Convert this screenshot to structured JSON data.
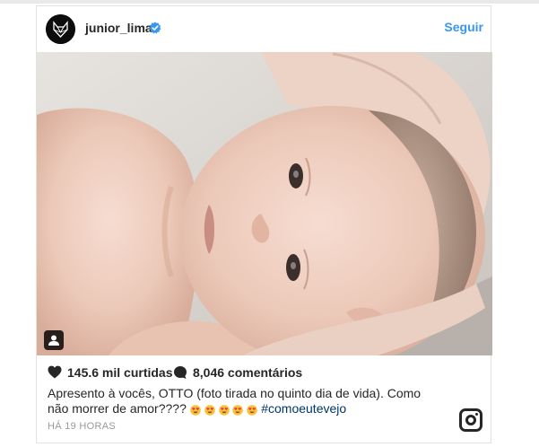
{
  "post": {
    "username": "junior_lima",
    "follow_label": "Seguir",
    "likes_text": "145.6 mil curtidas",
    "comments_text": "8,046 comentários",
    "caption_text": "Apresento à vocês, OTTO (foto tirada no quinto dia de vida). Como não morrer de amor????",
    "caption_emojis": [
      "heart-eyes-emoji",
      "heart-eyes-emoji",
      "heart-eyes-emoji",
      "heart-eyes-emoji",
      "heart-eyes-emoji"
    ],
    "hashtag": "#comoeutevejo",
    "time_text": "HÁ 19 HORAS"
  },
  "icons": {
    "avatar": "fox-logo-icon",
    "verified": "verified-badge-icon",
    "likes": "heart-icon",
    "comments": "comment-bubble-icon",
    "user_tags": "person-tag-icon",
    "brand": "instagram-icon"
  },
  "colors": {
    "accent": "#3897f0",
    "text": "#262626",
    "muted": "#999999",
    "hashtag": "#003569"
  }
}
